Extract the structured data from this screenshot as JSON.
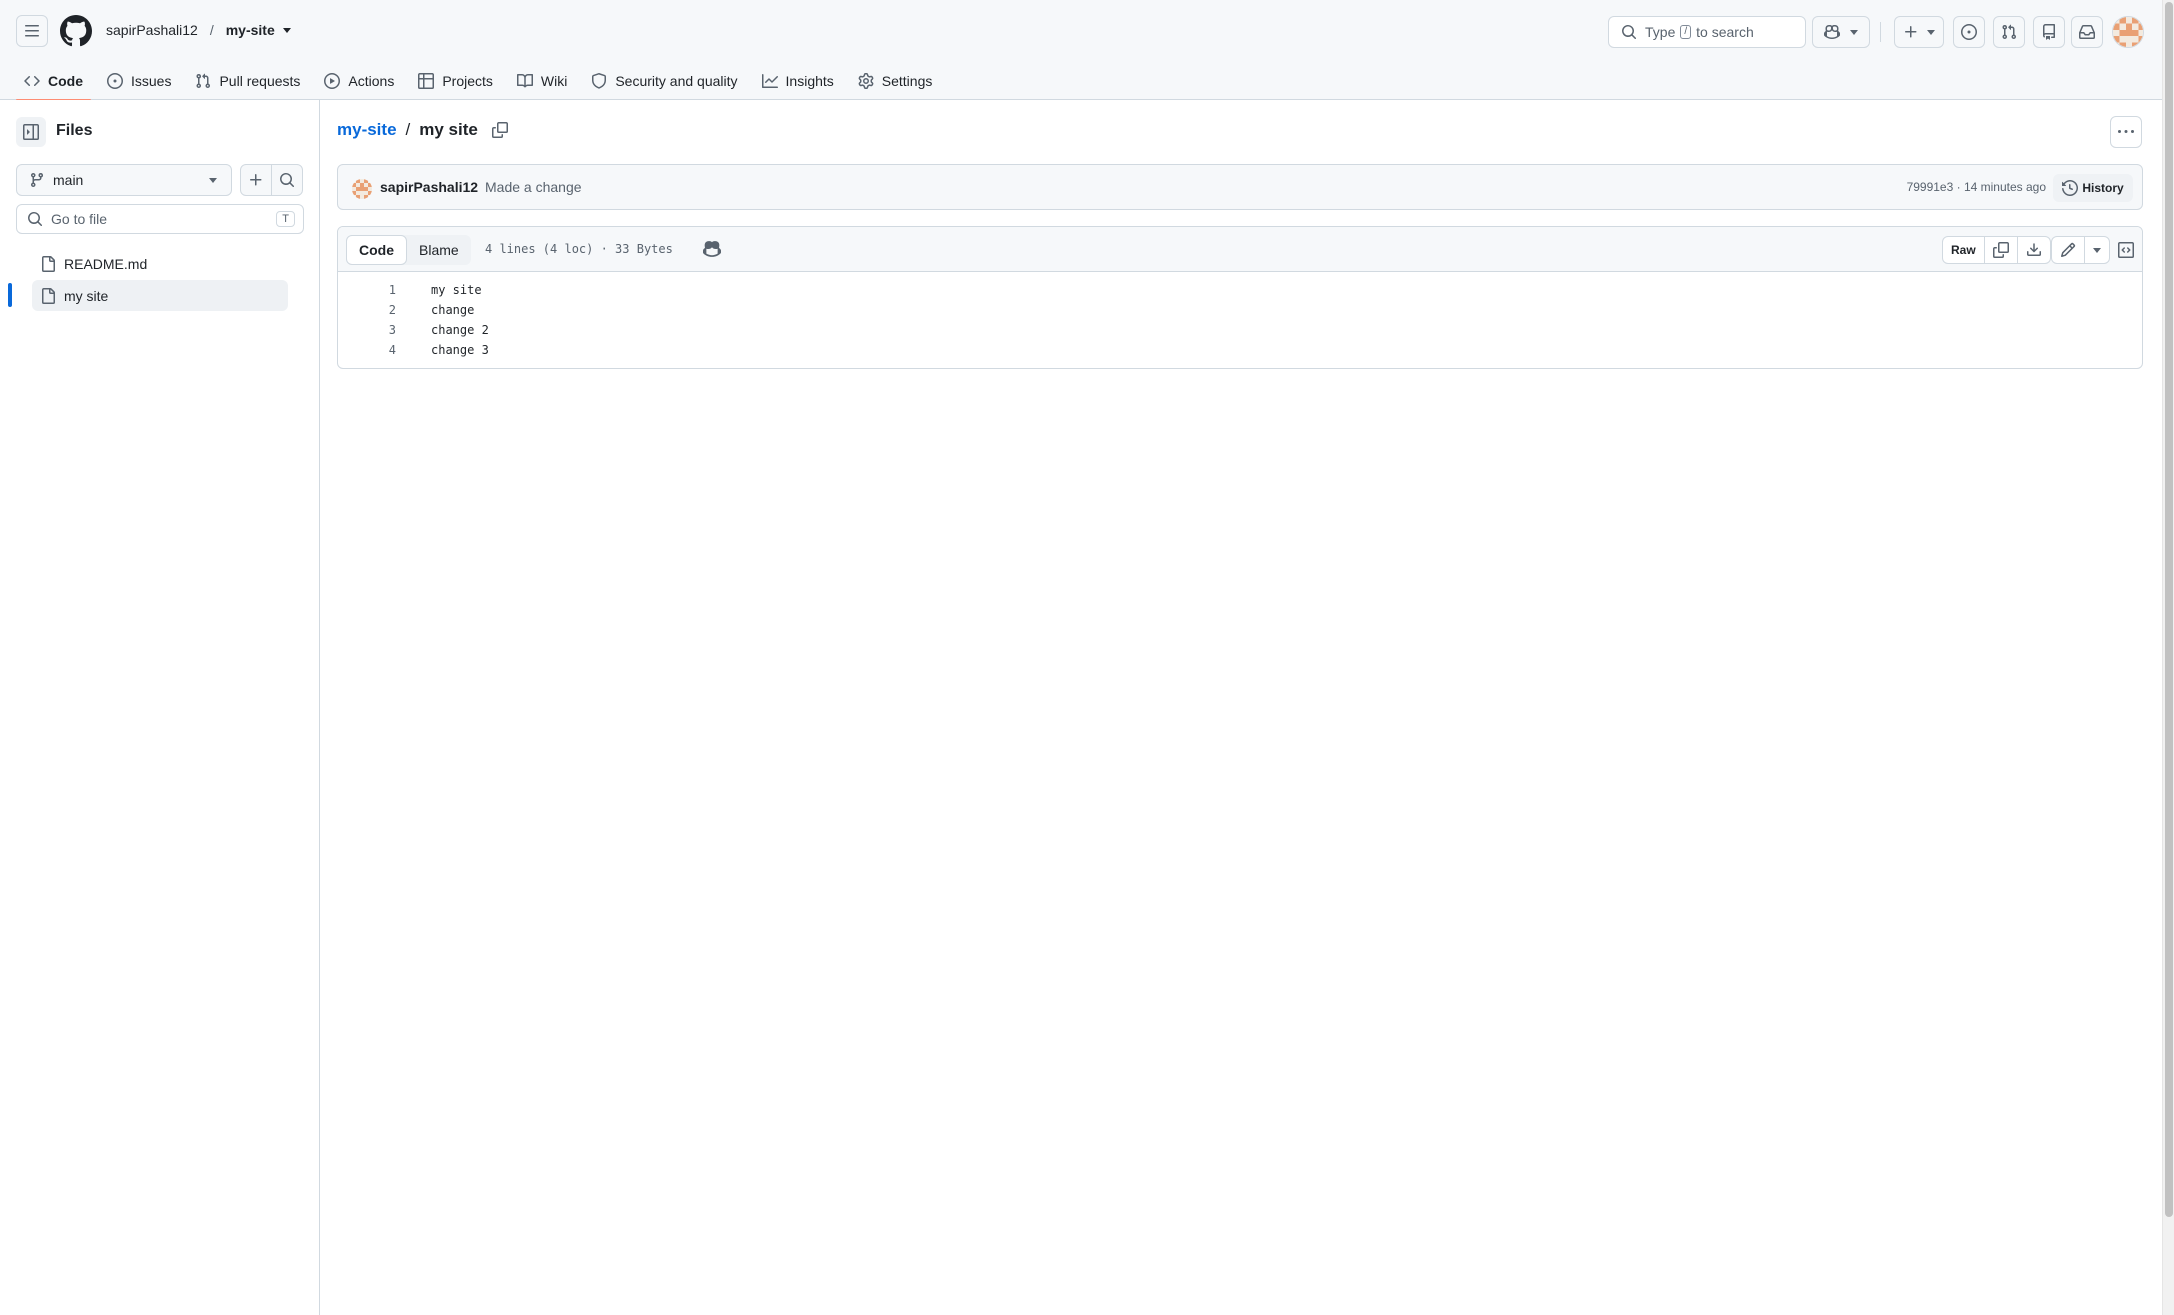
{
  "header": {
    "owner": "sapirPashali12",
    "separator": "/",
    "repo": "my-site",
    "search_prefix": "Type",
    "search_key": "/",
    "search_suffix": "to search"
  },
  "icons": {
    "menu": "hamburger-icon",
    "logo": "github-logo",
    "search": "search-icon",
    "copilot": "copilot-icon",
    "plus": "plus-icon",
    "issues": "issue-opened-icon",
    "pulls": "git-pull-request-icon",
    "repos": "repo-icon",
    "inbox": "inbox-icon"
  },
  "repo_nav": [
    {
      "label": "Code",
      "icon": "code-icon",
      "active": true
    },
    {
      "label": "Issues",
      "icon": "issue-icon"
    },
    {
      "label": "Pull requests",
      "icon": "pull-request-icon"
    },
    {
      "label": "Actions",
      "icon": "play-icon"
    },
    {
      "label": "Projects",
      "icon": "table-icon"
    },
    {
      "label": "Wiki",
      "icon": "book-icon"
    },
    {
      "label": "Security and quality",
      "icon": "shield-icon"
    },
    {
      "label": "Insights",
      "icon": "graph-icon"
    },
    {
      "label": "Settings",
      "icon": "gear-icon"
    }
  ],
  "sidebar": {
    "title": "Files",
    "branch": "main",
    "goto_placeholder": "Go to file",
    "goto_shortcut": "T",
    "files": [
      {
        "name": "README.md",
        "selected": false
      },
      {
        "name": "my site",
        "selected": true
      }
    ]
  },
  "breadcrumb": {
    "repo": "my-site",
    "separator": "/",
    "file": "my site"
  },
  "commit": {
    "author": "sapirPashali12",
    "message": "Made a change",
    "meta": "79991e3 · 14 minutes ago",
    "history_label": "History"
  },
  "file": {
    "tabs": [
      "Code",
      "Blame"
    ],
    "active_tab": "Code",
    "info": "4 lines (4 loc) · 33 Bytes",
    "raw_label": "Raw",
    "lines": [
      {
        "n": "1",
        "text": "my site"
      },
      {
        "n": "2",
        "text": "change"
      },
      {
        "n": "3",
        "text": "change 2"
      },
      {
        "n": "4",
        "text": "change 3"
      }
    ]
  },
  "colors": {
    "accent_link": "#0969da",
    "active_tab_underline": "#fd8c73",
    "selected_marker": "#0969da"
  }
}
